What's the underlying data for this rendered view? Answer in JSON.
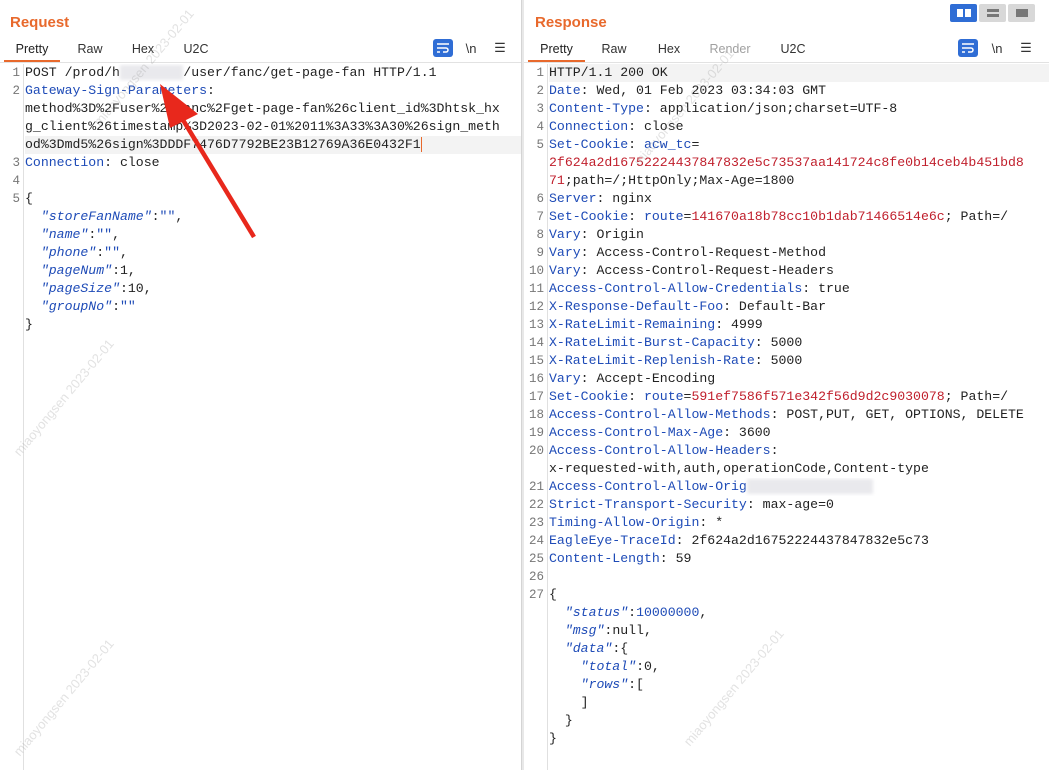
{
  "request": {
    "title": "Request",
    "tabs": [
      "Pretty",
      "Raw",
      "Hex",
      "U2C"
    ],
    "active_tab": "Pretty",
    "newline_toggle": "\\n",
    "lines": [
      {
        "n": "1",
        "parts": [
          {
            "t": "POST /prod/h",
            "c": ""
          },
          {
            "t": "        ",
            "c": "blur"
          },
          {
            "t": "/user/fanc/get-page-fan HTTP/1.1",
            "c": ""
          }
        ]
      },
      {
        "n": "2",
        "parts": [
          {
            "t": "Gateway-Sign-Parameters",
            "c": "hk"
          },
          {
            "t": ":",
            "c": ""
          }
        ]
      },
      {
        "n": "",
        "parts": [
          {
            "t": "method%3D%2Fuser%2Ffanc%2Fget-page-fan%26client_id%3Dhtsk_hx",
            "c": ""
          }
        ]
      },
      {
        "n": "",
        "parts": [
          {
            "t": "g_client%26timestamp%3D2023-02-01%2011%3A33%3A30%26sign_meth",
            "c": ""
          }
        ]
      },
      {
        "n": "",
        "parts": [
          {
            "t": "od%3Dmd5%26sign%3DDDF7476D7792BE23B12769A36E0432F1",
            "c": ""
          }
        ],
        "caret": true,
        "hl": true
      },
      {
        "n": "3",
        "parts": [
          {
            "t": "Connection",
            "c": "hk"
          },
          {
            "t": ": close",
            "c": ""
          }
        ]
      },
      {
        "n": "4",
        "parts": []
      },
      {
        "n": "5",
        "parts": [
          {
            "t": "{",
            "c": ""
          }
        ]
      },
      {
        "n": "",
        "parts": [
          {
            "t": "  ",
            "c": ""
          },
          {
            "t": "\"storeFanName\"",
            "c": "jk"
          },
          {
            "t": ":",
            "c": ""
          },
          {
            "t": "\"\"",
            "c": "jv"
          },
          {
            "t": ",",
            "c": ""
          }
        ]
      },
      {
        "n": "",
        "parts": [
          {
            "t": "  ",
            "c": ""
          },
          {
            "t": "\"name\"",
            "c": "jk"
          },
          {
            "t": ":",
            "c": ""
          },
          {
            "t": "\"\"",
            "c": "jv"
          },
          {
            "t": ",",
            "c": ""
          }
        ]
      },
      {
        "n": "",
        "parts": [
          {
            "t": "  ",
            "c": ""
          },
          {
            "t": "\"phone\"",
            "c": "jk"
          },
          {
            "t": ":",
            "c": ""
          },
          {
            "t": "\"\"",
            "c": "jv"
          },
          {
            "t": ",",
            "c": ""
          }
        ]
      },
      {
        "n": "",
        "parts": [
          {
            "t": "  ",
            "c": ""
          },
          {
            "t": "\"pageNum\"",
            "c": "jk"
          },
          {
            "t": ":1,",
            "c": ""
          }
        ]
      },
      {
        "n": "",
        "parts": [
          {
            "t": "  ",
            "c": ""
          },
          {
            "t": "\"pageSize\"",
            "c": "jk"
          },
          {
            "t": ":10,",
            "c": ""
          }
        ]
      },
      {
        "n": "",
        "parts": [
          {
            "t": "  ",
            "c": ""
          },
          {
            "t": "\"groupNo\"",
            "c": "jk"
          },
          {
            "t": ":",
            "c": ""
          },
          {
            "t": "\"\"",
            "c": "jv"
          }
        ]
      },
      {
        "n": "",
        "parts": [
          {
            "t": "}",
            "c": ""
          }
        ]
      }
    ]
  },
  "response": {
    "title": "Response",
    "tabs": [
      "Pretty",
      "Raw",
      "Hex",
      "Render",
      "U2C"
    ],
    "active_tab": "Pretty",
    "disabled_tab": "Render",
    "newline_toggle": "\\n",
    "lines": [
      {
        "n": "1",
        "parts": [
          {
            "t": "HTTP/1.1 200 OK",
            "c": ""
          }
        ],
        "hl": true
      },
      {
        "n": "2",
        "parts": [
          {
            "t": "Date",
            "c": "hk"
          },
          {
            "t": ": Wed, 01 Feb 2023 03:34:03 GMT",
            "c": ""
          }
        ]
      },
      {
        "n": "3",
        "parts": [
          {
            "t": "Content-Type",
            "c": "hk"
          },
          {
            "t": ": application/json;charset=UTF-8",
            "c": ""
          }
        ]
      },
      {
        "n": "4",
        "parts": [
          {
            "t": "Connection",
            "c": "hk"
          },
          {
            "t": ": close",
            "c": ""
          }
        ]
      },
      {
        "n": "5",
        "parts": [
          {
            "t": "Set-Cookie",
            "c": "hk"
          },
          {
            "t": ": ",
            "c": ""
          },
          {
            "t": "acw_tc",
            "c": "hk"
          },
          {
            "t": "=",
            "c": ""
          }
        ]
      },
      {
        "n": "",
        "parts": [
          {
            "t": "2f624a2d16752224437847832e5c73537aa141724c8fe0b14ceb4b451bd8",
            "c": "rv"
          }
        ]
      },
      {
        "n": "",
        "parts": [
          {
            "t": "71",
            "c": "rv"
          },
          {
            "t": ";path=/;HttpOnly;Max-Age=1800",
            "c": ""
          }
        ]
      },
      {
        "n": "6",
        "parts": [
          {
            "t": "Server",
            "c": "hk"
          },
          {
            "t": ": nginx",
            "c": ""
          }
        ]
      },
      {
        "n": "7",
        "parts": [
          {
            "t": "Set-Cookie",
            "c": "hk"
          },
          {
            "t": ": ",
            "c": ""
          },
          {
            "t": "route",
            "c": "hk"
          },
          {
            "t": "=",
            "c": ""
          },
          {
            "t": "141670a18b78cc10b1dab71466514e6c",
            "c": "rv"
          },
          {
            "t": "; Path=/",
            "c": ""
          }
        ]
      },
      {
        "n": "8",
        "parts": [
          {
            "t": "Vary",
            "c": "hk"
          },
          {
            "t": ": Origin",
            "c": ""
          }
        ]
      },
      {
        "n": "9",
        "parts": [
          {
            "t": "Vary",
            "c": "hk"
          },
          {
            "t": ": Access-Control-Request-Method",
            "c": ""
          }
        ]
      },
      {
        "n": "10",
        "parts": [
          {
            "t": "Vary",
            "c": "hk"
          },
          {
            "t": ": Access-Control-Request-Headers",
            "c": ""
          }
        ]
      },
      {
        "n": "11",
        "parts": [
          {
            "t": "Access-Control-Allow-Credentials",
            "c": "hk"
          },
          {
            "t": ": true",
            "c": ""
          }
        ]
      },
      {
        "n": "12",
        "parts": [
          {
            "t": "X-Response-Default-Foo",
            "c": "hk"
          },
          {
            "t": ": Default-Bar",
            "c": ""
          }
        ]
      },
      {
        "n": "13",
        "parts": [
          {
            "t": "X-RateLimit-Remaining",
            "c": "hk"
          },
          {
            "t": ": 4999",
            "c": ""
          }
        ]
      },
      {
        "n": "14",
        "parts": [
          {
            "t": "X-RateLimit-Burst-Capacity",
            "c": "hk"
          },
          {
            "t": ": 5000",
            "c": ""
          }
        ]
      },
      {
        "n": "15",
        "parts": [
          {
            "t": "X-RateLimit-Replenish-Rate",
            "c": "hk"
          },
          {
            "t": ": 5000",
            "c": ""
          }
        ]
      },
      {
        "n": "16",
        "parts": [
          {
            "t": "Vary",
            "c": "hk"
          },
          {
            "t": ": Accept-Encoding",
            "c": ""
          }
        ]
      },
      {
        "n": "17",
        "parts": [
          {
            "t": "Set-Cookie",
            "c": "hk"
          },
          {
            "t": ": ",
            "c": ""
          },
          {
            "t": "route",
            "c": "hk"
          },
          {
            "t": "=",
            "c": ""
          },
          {
            "t": "591ef7586f571e342f56d9d2c9030078",
            "c": "rv"
          },
          {
            "t": "; Path=/",
            "c": ""
          }
        ]
      },
      {
        "n": "18",
        "parts": [
          {
            "t": "Access-Control-Allow-Methods",
            "c": "hk"
          },
          {
            "t": ": POST,PUT, GET, OPTIONS, DELETE",
            "c": ""
          }
        ]
      },
      {
        "n": "19",
        "parts": [
          {
            "t": "Access-Control-Max-Age",
            "c": "hk"
          },
          {
            "t": ": 3600",
            "c": ""
          }
        ]
      },
      {
        "n": "20",
        "parts": [
          {
            "t": "Access-Control-Allow-Headers",
            "c": "hk"
          },
          {
            "t": ":",
            "c": ""
          }
        ]
      },
      {
        "n": "",
        "parts": [
          {
            "t": "x-requested-with,auth,operationCode,Content-type",
            "c": ""
          }
        ]
      },
      {
        "n": "21",
        "parts": [
          {
            "t": "Access-Control-Allow-Orig",
            "c": "hk"
          },
          {
            "t": "                ",
            "c": "blur"
          }
        ]
      },
      {
        "n": "22",
        "parts": [
          {
            "t": "Strict-Transport-Security",
            "c": "hk"
          },
          {
            "t": ": max-age=0",
            "c": ""
          }
        ]
      },
      {
        "n": "23",
        "parts": [
          {
            "t": "Timing-Allow-Origin",
            "c": "hk"
          },
          {
            "t": ": *",
            "c": ""
          }
        ]
      },
      {
        "n": "24",
        "parts": [
          {
            "t": "EagleEye-TraceId",
            "c": "hk"
          },
          {
            "t": ": 2f624a2d16752224437847832e5c73",
            "c": ""
          }
        ]
      },
      {
        "n": "25",
        "parts": [
          {
            "t": "Content-Length",
            "c": "hk"
          },
          {
            "t": ": 59",
            "c": ""
          }
        ]
      },
      {
        "n": "26",
        "parts": []
      },
      {
        "n": "27",
        "parts": [
          {
            "t": "{",
            "c": ""
          }
        ]
      },
      {
        "n": "",
        "parts": [
          {
            "t": "  ",
            "c": ""
          },
          {
            "t": "\"status\"",
            "c": "jk"
          },
          {
            "t": ":",
            "c": ""
          },
          {
            "t": "10000000",
            "c": "jv"
          },
          {
            "t": ",",
            "c": ""
          }
        ]
      },
      {
        "n": "",
        "parts": [
          {
            "t": "  ",
            "c": ""
          },
          {
            "t": "\"msg\"",
            "c": "jk"
          },
          {
            "t": ":null,",
            "c": ""
          }
        ]
      },
      {
        "n": "",
        "parts": [
          {
            "t": "  ",
            "c": ""
          },
          {
            "t": "\"data\"",
            "c": "jk"
          },
          {
            "t": ":{",
            "c": ""
          }
        ]
      },
      {
        "n": "",
        "parts": [
          {
            "t": "    ",
            "c": ""
          },
          {
            "t": "\"total\"",
            "c": "jk"
          },
          {
            "t": ":0,",
            "c": ""
          }
        ]
      },
      {
        "n": "",
        "parts": [
          {
            "t": "    ",
            "c": ""
          },
          {
            "t": "\"rows\"",
            "c": "jk"
          },
          {
            "t": ":[",
            "c": ""
          }
        ]
      },
      {
        "n": "",
        "parts": [
          {
            "t": "    ]",
            "c": ""
          }
        ]
      },
      {
        "n": "",
        "parts": [
          {
            "t": "  }",
            "c": ""
          }
        ]
      },
      {
        "n": "",
        "parts": [
          {
            "t": "}",
            "c": ""
          }
        ]
      }
    ]
  },
  "layout_buttons": [
    "split-horizontal",
    "split-vertical",
    "tabs-view"
  ],
  "active_layout": "split-horizontal",
  "watermark_text": "miaoyongsen 2023-02-01",
  "colors": {
    "accent": "#e8692c",
    "blue": "#2f6dd5",
    "header_key": "#1e4bb7",
    "value_red": "#c01f2c"
  }
}
